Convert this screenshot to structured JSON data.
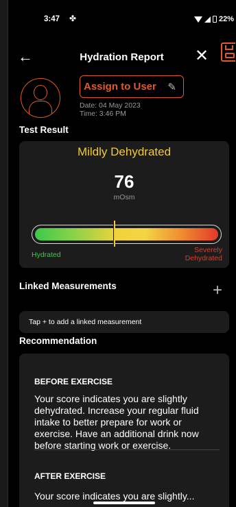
{
  "status_bar": {
    "time": "3:47",
    "settings_glyph": "✤",
    "battery": "22%"
  },
  "header": {
    "back_icon": "←",
    "title": "Hydration Report",
    "close_icon": "✕"
  },
  "user": {
    "assign_label": "Assign to User",
    "pencil_icon": "✎",
    "date": "Date: 04 May 2023",
    "time": "Time: 3:46 PM"
  },
  "result": {
    "section_title": "Test Result",
    "status": "Mildly Dehydrated",
    "status_color": "#f2cb3a",
    "score": "76",
    "unit": "mOsm",
    "gauge_position_fraction": 0.43,
    "low_label": "Hydrated",
    "high_label_line1": "Severely",
    "high_label_line2": "Dehydrated"
  },
  "linked": {
    "section_title": "Linked Measurements",
    "add_icon": "+",
    "hint": "Tap + to add a linked measurement"
  },
  "recommendation": {
    "section_title": "Recommendation",
    "before_title": "BEFORE EXERCISE",
    "before_text": "Your score indicates you are slightly dehydrated. Increase your regular fluid intake to better prepare for work or exercise. Have an additional drink now before starting work or exercise.",
    "after_title": "AFTER EXERCISE",
    "after_text": "Your score indicates you are slightly..."
  },
  "colors": {
    "accent": "#e05a2b",
    "card": "#1c1c1c",
    "green": "#3cc94a",
    "red": "#e23a2a"
  }
}
